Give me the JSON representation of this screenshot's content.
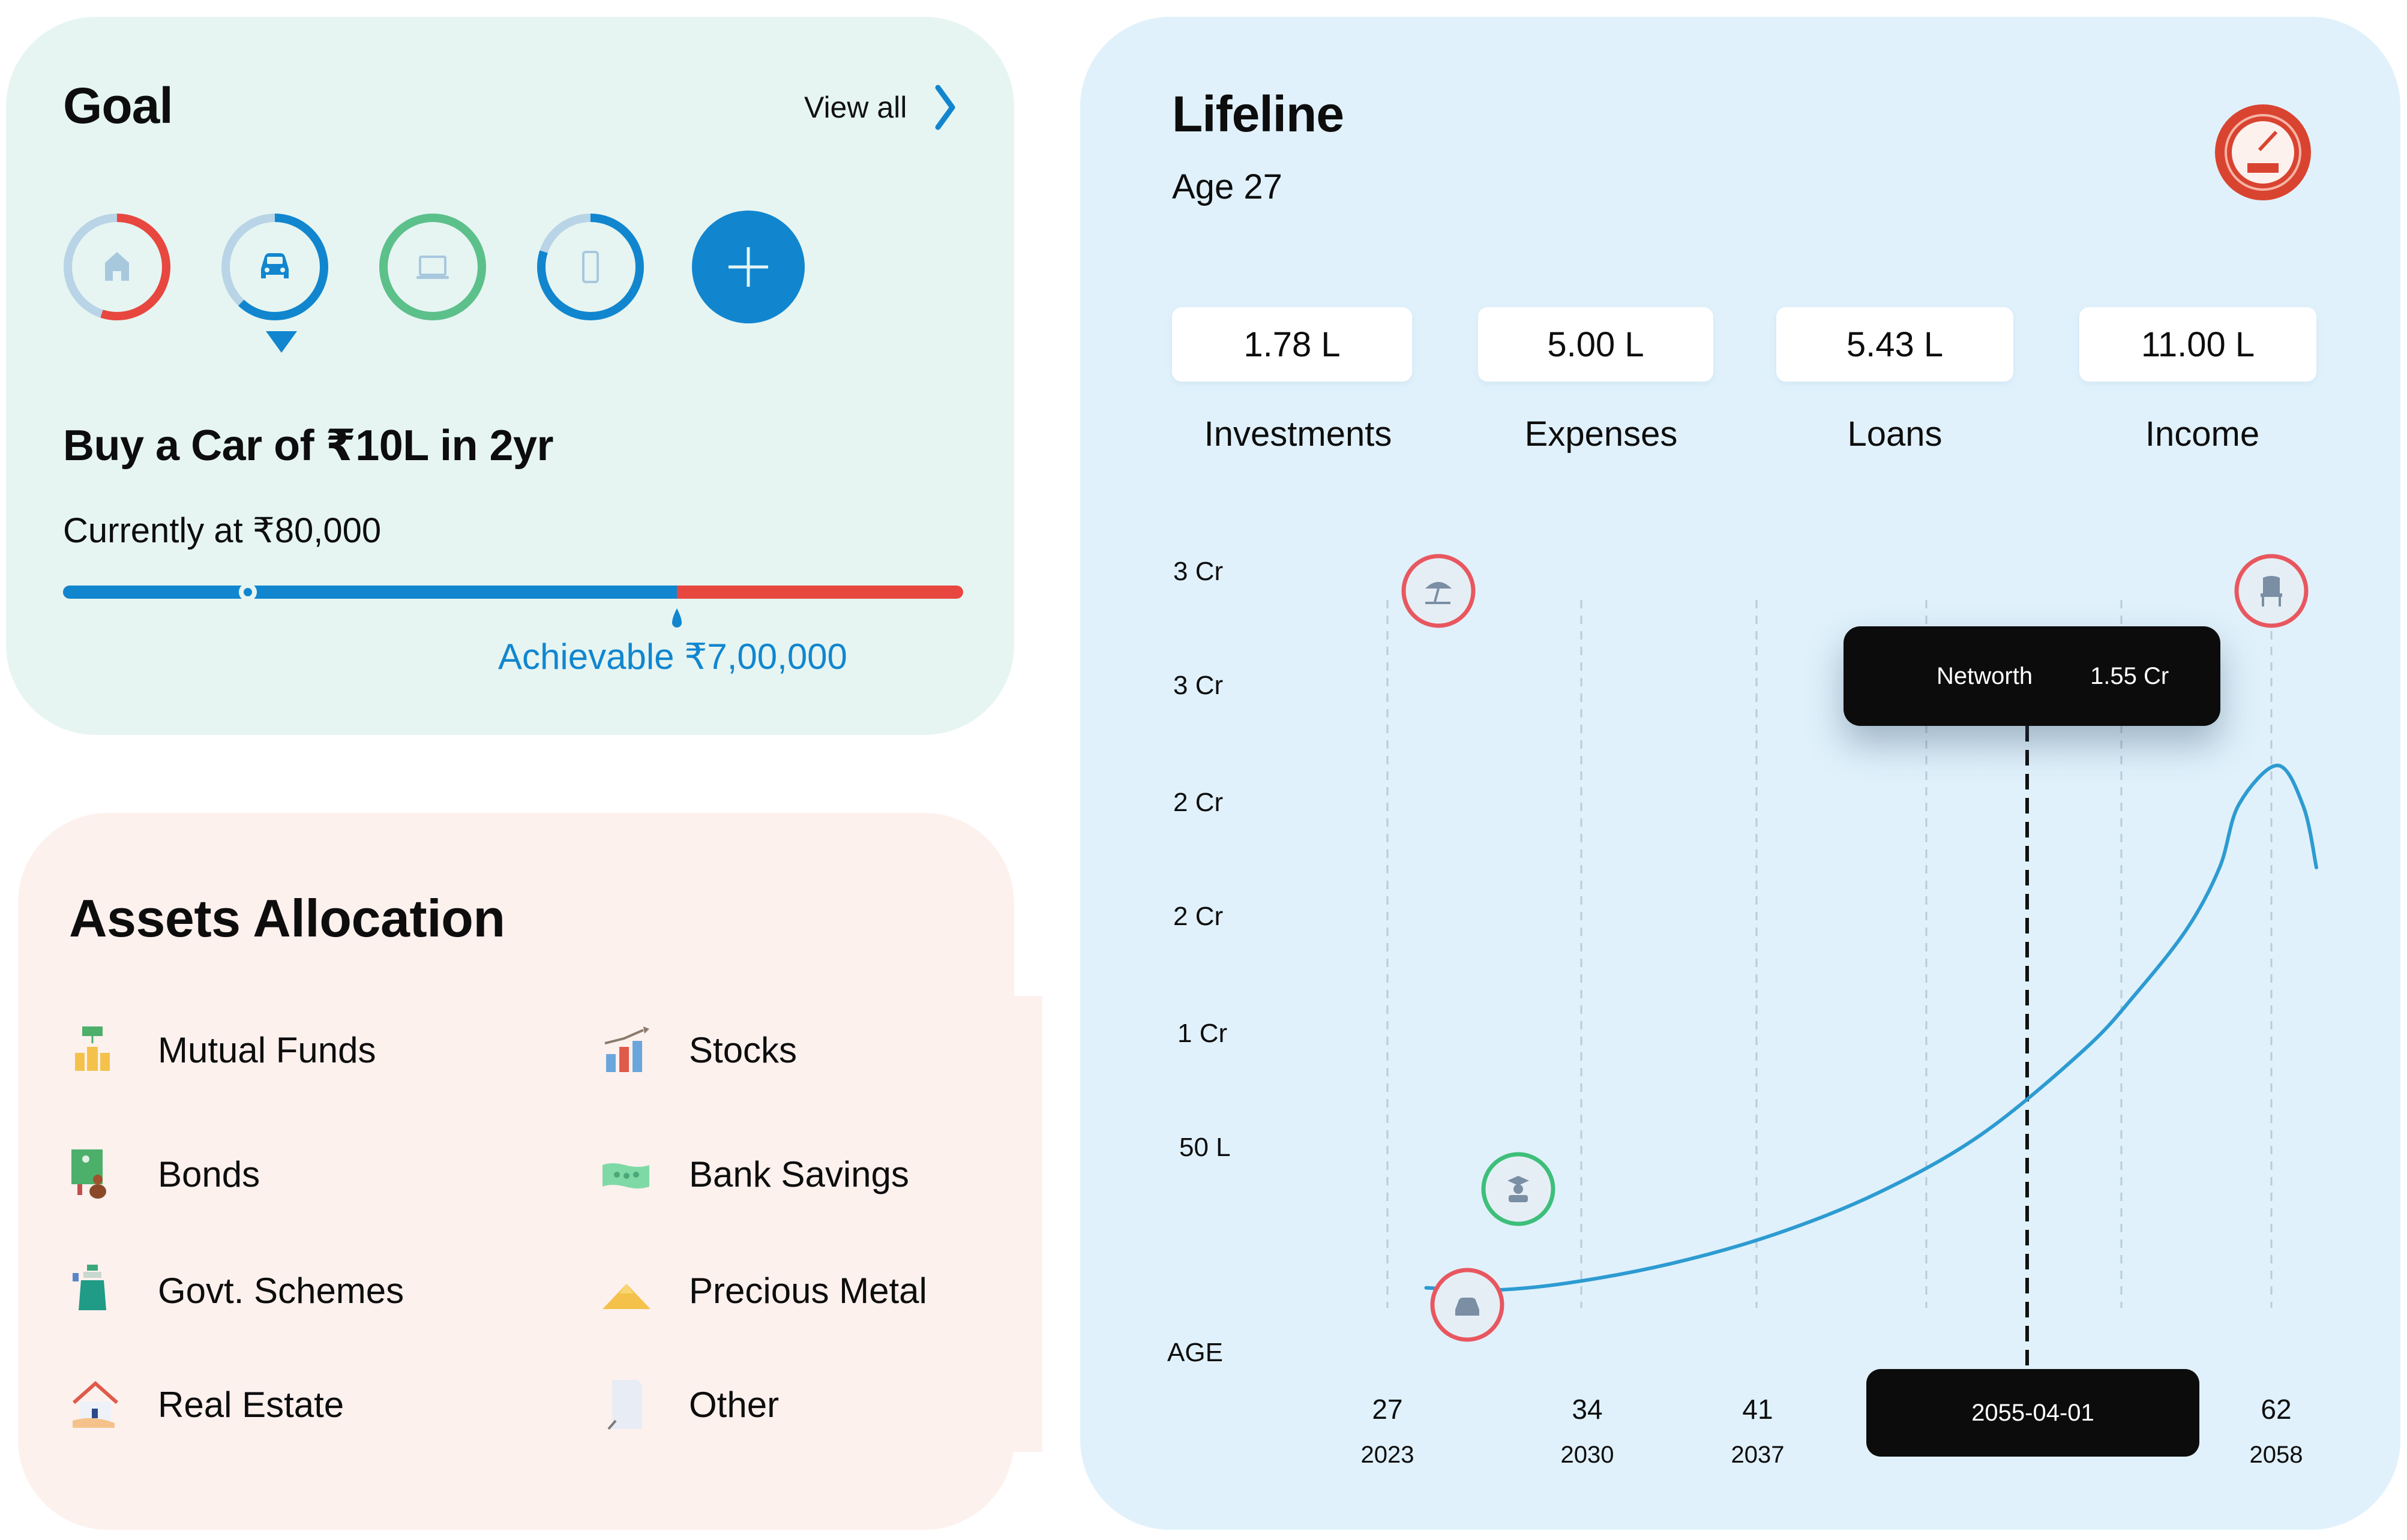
{
  "goal": {
    "title": "Goal",
    "view_all_label": "View all",
    "rings": [
      {
        "name": "home",
        "icon": "home-icon",
        "progress_pct": 55,
        "color": "#e8473f",
        "track": "#b8d4e6"
      },
      {
        "name": "car",
        "icon": "car-icon",
        "progress_pct": 62,
        "color": "#1186cf",
        "track": "#b8d4e6",
        "selected": true
      },
      {
        "name": "laptop",
        "icon": "laptop-icon",
        "progress_pct": 100,
        "color": "#5cc08a",
        "track": "#b8d4e6"
      },
      {
        "name": "phone",
        "icon": "phone-icon",
        "progress_pct": 80,
        "color": "#1186cf",
        "track": "#b8d4e6"
      }
    ],
    "add_button_icon": "plus-icon",
    "goal_name": "Buy a Car of ₹10L in 2yr",
    "current_text": "Currently at ₹80,000",
    "current_pct": 20.5,
    "achievable_pct": 68.2,
    "achievable_text": "Achievable ₹7,00,000"
  },
  "assets": {
    "title": "Assets Allocation",
    "items": [
      {
        "label": "Mutual Funds",
        "icon": "mutual-funds-icon"
      },
      {
        "label": "Stocks",
        "icon": "stocks-icon"
      },
      {
        "label": "Bonds",
        "icon": "bonds-icon"
      },
      {
        "label": "Bank Savings",
        "icon": "bank-savings-icon"
      },
      {
        "label": "Govt. Schemes",
        "icon": "govt-schemes-icon"
      },
      {
        "label": "Precious Metal",
        "icon": "precious-metal-icon"
      },
      {
        "label": "Real Estate",
        "icon": "real-estate-icon"
      },
      {
        "label": "Other",
        "icon": "other-document-icon"
      }
    ]
  },
  "lifeline": {
    "title": "Lifeline",
    "age_text": "Age 27",
    "status_icon": "speedometer-icon",
    "stats": [
      {
        "value": "1.78 L",
        "label": "Investments"
      },
      {
        "value": "5.00 L",
        "label": "Expenses"
      },
      {
        "value": "5.43 L",
        "label": "Loans"
      },
      {
        "value": "11.00 L",
        "label": "Income"
      }
    ],
    "tooltip": {
      "label": "Networth",
      "value": "1.55 Cr"
    },
    "date_tooltip": "2055-04-01",
    "colors": {
      "line": "#2d9bd1",
      "tooltip_bg": "#0c0c0c"
    }
  },
  "chart_data": {
    "type": "line",
    "title": "",
    "xlabel": "AGE",
    "ylabel": "",
    "y_tick_labels": [
      "3 Cr",
      "3 Cr",
      "2 Cr",
      "2 Cr",
      "1 Cr",
      "50 L"
    ],
    "x_ticks": [
      {
        "age": "27",
        "year": "2023"
      },
      {
        "age": "34",
        "year": "2030"
      },
      {
        "age": "41",
        "year": "2037"
      },
      {
        "age": "62",
        "year": "2058"
      }
    ],
    "x_range_years": [
      2023,
      2059
    ],
    "y_range_cr": [
      0,
      3.0
    ],
    "grid": "vertical-dashed",
    "series": [
      {
        "name": "Networth",
        "x": [
          2024.5,
          2027,
          2030,
          2034,
          2038,
          2042,
          2046,
          2050,
          2052,
          2054,
          2055.25,
          2056,
          2057.5,
          2058.5,
          2059
        ],
        "y": [
          0.07,
          0.06,
          0.09,
          0.17,
          0.29,
          0.46,
          0.7,
          1.05,
          1.28,
          1.55,
          1.8,
          2.06,
          2.22,
          2.05,
          1.8
        ]
      }
    ],
    "events": [
      {
        "name": "car",
        "icon": "car-icon",
        "year": 2024.5,
        "value_cr": 0.07,
        "ring": "#e8575f"
      },
      {
        "name": "education",
        "icon": "graduation-icon",
        "year": 2025.5,
        "value_cr": 0.42,
        "ring": "#3dbf7a"
      },
      {
        "name": "vacation",
        "icon": "beach-umbrella-icon",
        "year": 2024.0,
        "value_cr": 2.83,
        "ring": "#e8575f"
      },
      {
        "name": "retirement",
        "icon": "chair-icon",
        "year": 2058.0,
        "value_cr": 2.83,
        "ring": "#e8575f"
      }
    ],
    "highlight": {
      "date": "2055-04-01",
      "value": "1.55 Cr"
    }
  }
}
